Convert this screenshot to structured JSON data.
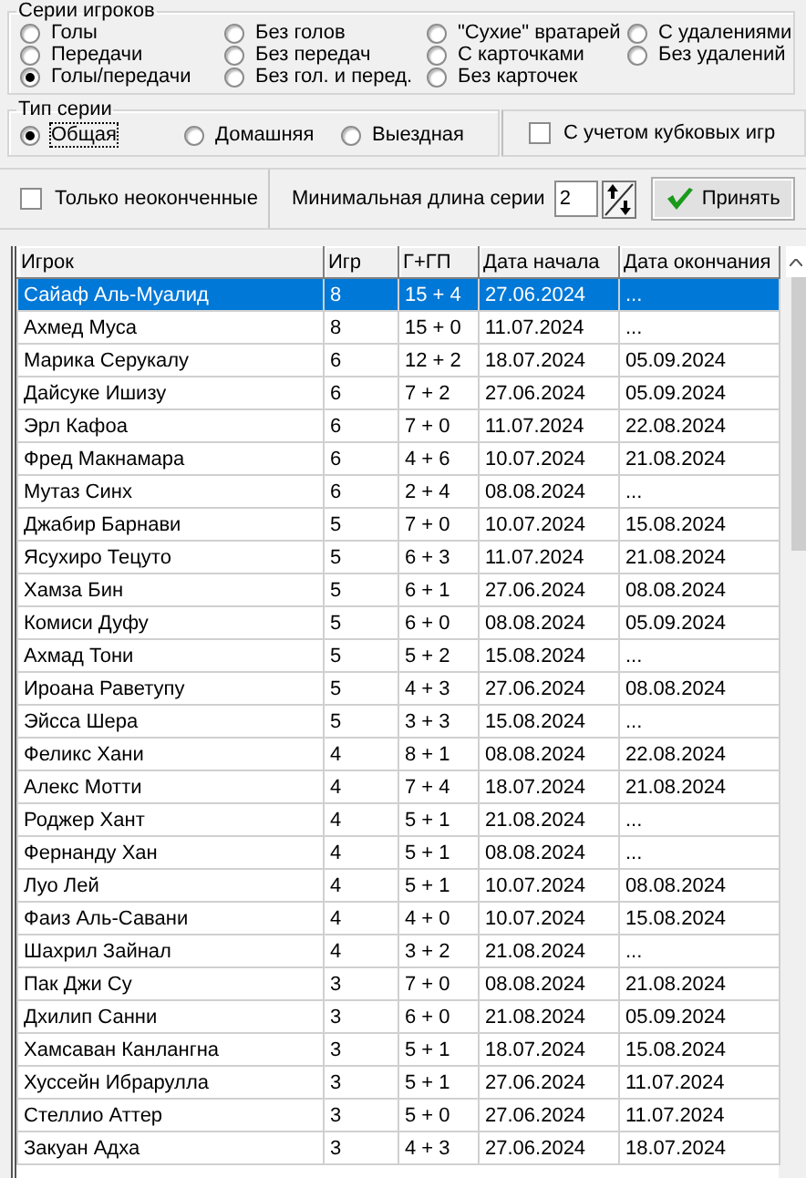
{
  "series_group": {
    "title": "Серии игроков",
    "options": [
      {
        "label": "Голы",
        "selected": false
      },
      {
        "label": "Передачи",
        "selected": false
      },
      {
        "label": "Голы/передачи",
        "selected": true
      },
      {
        "label": "Без голов",
        "selected": false
      },
      {
        "label": "Без передач",
        "selected": false
      },
      {
        "label": "Без гол. и перед.",
        "selected": false
      },
      {
        "label": "\"Сухие\" вратарей",
        "selected": false
      },
      {
        "label": "С карточками",
        "selected": false
      },
      {
        "label": "Без карточек",
        "selected": false
      },
      {
        "label": "С удалениями",
        "selected": false
      },
      {
        "label": "Без удалений",
        "selected": false
      }
    ]
  },
  "type_group": {
    "title": "Тип серии",
    "options": [
      {
        "label": "Общая",
        "selected": true
      },
      {
        "label": "Домашняя",
        "selected": false
      },
      {
        "label": "Выездная",
        "selected": false
      }
    ]
  },
  "cup_checkbox": {
    "label": "С учетом кубковых игр",
    "checked": false
  },
  "unfinished_checkbox": {
    "label": "Только неоконченные",
    "checked": false
  },
  "min_length": {
    "label": "Минимальная длина серии",
    "value": "2"
  },
  "apply_button": {
    "label": "Принять"
  },
  "table": {
    "columns": [
      "Игрок",
      "Игр",
      "Г+ГП",
      "Дата начала",
      "Дата окончания"
    ],
    "rows": [
      {
        "cells": [
          "Сайаф Аль-Муалид",
          "8",
          "15 + 4",
          "27.06.2024",
          "..."
        ],
        "selected": true
      },
      {
        "cells": [
          "Ахмед Муса",
          "8",
          "15 + 0",
          "11.07.2024",
          "..."
        ],
        "selected": false
      },
      {
        "cells": [
          "Марика Серукалу",
          "6",
          "12 + 2",
          "18.07.2024",
          "05.09.2024"
        ],
        "selected": false
      },
      {
        "cells": [
          "Дайсуке Ишизу",
          "6",
          "7 + 2",
          "27.06.2024",
          "05.09.2024"
        ],
        "selected": false
      },
      {
        "cells": [
          "Эрл Кафоа",
          "6",
          "7 + 0",
          "11.07.2024",
          "22.08.2024"
        ],
        "selected": false
      },
      {
        "cells": [
          "Фред Макнамара",
          "6",
          "4 + 6",
          "10.07.2024",
          "21.08.2024"
        ],
        "selected": false
      },
      {
        "cells": [
          "Мутаз Синх",
          "6",
          "2 + 4",
          "08.08.2024",
          "..."
        ],
        "selected": false
      },
      {
        "cells": [
          "Джабир Барнави",
          "5",
          "7 + 0",
          "10.07.2024",
          "15.08.2024"
        ],
        "selected": false
      },
      {
        "cells": [
          "Ясухиро Тецуто",
          "5",
          "6 + 3",
          "11.07.2024",
          "21.08.2024"
        ],
        "selected": false
      },
      {
        "cells": [
          "Хамза Бин",
          "5",
          "6 + 1",
          "27.06.2024",
          "08.08.2024"
        ],
        "selected": false
      },
      {
        "cells": [
          "Комиси Дуфу",
          "5",
          "6 + 0",
          "08.08.2024",
          "05.09.2024"
        ],
        "selected": false
      },
      {
        "cells": [
          "Ахмад Тони",
          "5",
          "5 + 2",
          "15.08.2024",
          "..."
        ],
        "selected": false
      },
      {
        "cells": [
          "Ироана Раветупу",
          "5",
          "4 + 3",
          "27.06.2024",
          "08.08.2024"
        ],
        "selected": false
      },
      {
        "cells": [
          "Эйсса Шера",
          "5",
          "3 + 3",
          "15.08.2024",
          "..."
        ],
        "selected": false
      },
      {
        "cells": [
          "Феликс Хани",
          "4",
          "8 + 1",
          "08.08.2024",
          "22.08.2024"
        ],
        "selected": false
      },
      {
        "cells": [
          "Алекс Мотти",
          "4",
          "7 + 4",
          "18.07.2024",
          "21.08.2024"
        ],
        "selected": false
      },
      {
        "cells": [
          "Роджер Хант",
          "4",
          "5 + 1",
          "21.08.2024",
          "..."
        ],
        "selected": false
      },
      {
        "cells": [
          "Фернанду Хан",
          "4",
          "5 + 1",
          "08.08.2024",
          "..."
        ],
        "selected": false
      },
      {
        "cells": [
          "Луо Лей",
          "4",
          "5 + 1",
          "10.07.2024",
          "08.08.2024"
        ],
        "selected": false
      },
      {
        "cells": [
          "Фаиз Аль-Савани",
          "4",
          "4 + 0",
          "10.07.2024",
          "15.08.2024"
        ],
        "selected": false
      },
      {
        "cells": [
          "Шахрил Зайнал",
          "4",
          "3 + 2",
          "21.08.2024",
          "..."
        ],
        "selected": false
      },
      {
        "cells": [
          "Пак Джи Су",
          "3",
          "7 + 0",
          "08.08.2024",
          "21.08.2024"
        ],
        "selected": false
      },
      {
        "cells": [
          "Дхилип Санни",
          "3",
          "6 + 0",
          "21.08.2024",
          "05.09.2024"
        ],
        "selected": false
      },
      {
        "cells": [
          "Хамсаван Канлангна",
          "3",
          "5 + 1",
          "18.07.2024",
          "15.08.2024"
        ],
        "selected": false
      },
      {
        "cells": [
          "Хуссейн Ибрарулла",
          "3",
          "5 + 1",
          "27.06.2024",
          "11.07.2024"
        ],
        "selected": false
      },
      {
        "cells": [
          "Стеллио Аттер",
          "3",
          "5 + 0",
          "27.06.2024",
          "11.07.2024"
        ],
        "selected": false
      },
      {
        "cells": [
          "Закуан Адха",
          "3",
          "4 + 3",
          "27.06.2024",
          "18.07.2024"
        ],
        "selected": false
      }
    ]
  }
}
